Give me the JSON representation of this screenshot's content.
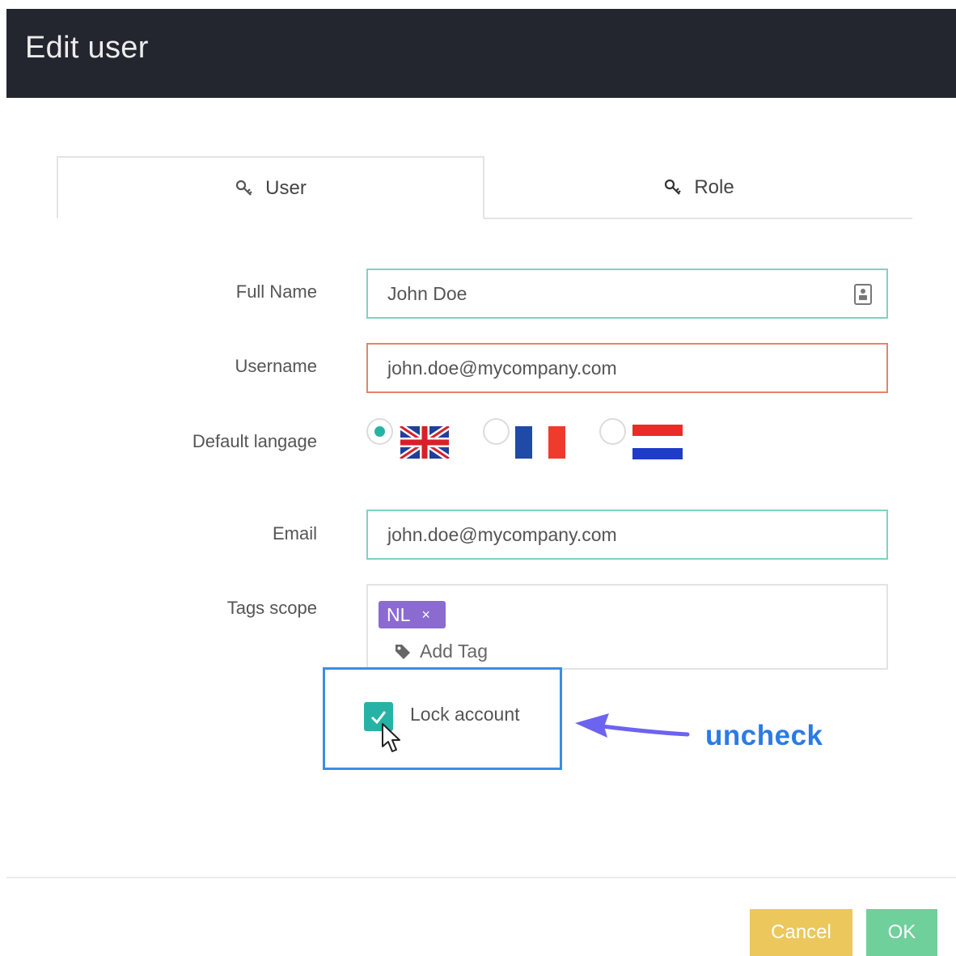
{
  "dialog": {
    "title": "Edit user"
  },
  "tabs": [
    {
      "label": "User",
      "icon": "key-icon",
      "active": true
    },
    {
      "label": "Role",
      "icon": "key-icon",
      "active": false
    }
  ],
  "form": {
    "full_name": {
      "label": "Full Name",
      "value": "John Doe",
      "icon": "contact-card-icon"
    },
    "username": {
      "label": "Username",
      "value": "john.doe@mycompany.com",
      "state": "error"
    },
    "default_language": {
      "label": "Default langage",
      "options": [
        {
          "flag": "uk-flag",
          "selected": true
        },
        {
          "flag": "france-flag",
          "selected": false
        },
        {
          "flag": "netherlands-flag",
          "selected": false
        }
      ]
    },
    "email": {
      "label": "Email",
      "value": "john.doe@mycompany.com"
    },
    "tags_scope": {
      "label": "Tags scope",
      "tags": [
        {
          "text": "NL",
          "remove": "×"
        }
      ],
      "add_placeholder": "Add Tag"
    },
    "lock_account": {
      "label": "Lock account",
      "checked": true
    }
  },
  "annotation": {
    "text": "uncheck"
  },
  "footer": {
    "cancel_label": "Cancel",
    "ok_label": "OK"
  },
  "colors": {
    "header_bg": "#23252f",
    "teal_accent": "#26b3a6",
    "valid_border": "#7dd3c0",
    "error_border": "#e8836a",
    "tag_purple": "#8b6bd0",
    "annotation_blue": "#2c7be5",
    "cancel_yellow": "#ecc75c",
    "ok_green": "#6fd09b"
  }
}
